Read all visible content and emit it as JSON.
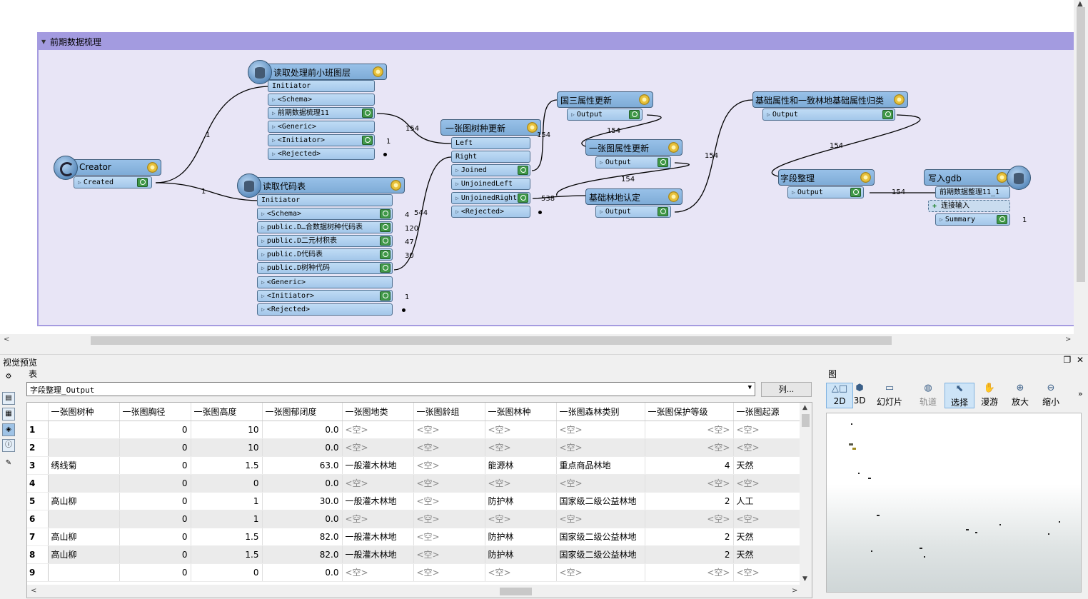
{
  "bookmark": {
    "title": "前期数据梳理"
  },
  "nodes": {
    "creator": {
      "title": "Creator",
      "ports": [
        "Created"
      ]
    },
    "reader1": {
      "title": "读取处理前小班图层",
      "init": "Initiator",
      "ports": [
        "<Schema>",
        "前期数据梳理11",
        "<Generic>",
        "<Initiator>",
        "<Rejected>"
      ]
    },
    "reader2": {
      "title": "读取代码表",
      "init": "Initiator",
      "ports": [
        "<Schema>",
        "public.D…合数据树种代码表",
        "public.D二元材积表",
        "public.D代码表",
        "public.D树种代码",
        "<Generic>",
        "<Initiator>",
        "<Rejected>"
      ]
    },
    "merger": {
      "title": "一张图树种更新",
      "inputs": [
        "Left",
        "Right"
      ],
      "ports": [
        "Joined",
        "UnjoinedLeft",
        "UnjoinedRight",
        "<Rejected>"
      ]
    },
    "t1": {
      "title": "国三属性更新",
      "ports": [
        "Output"
      ]
    },
    "t2": {
      "title": "一张图属性更新",
      "ports": [
        "Output"
      ]
    },
    "t3": {
      "title": "基础林地认定",
      "ports": [
        "Output"
      ]
    },
    "t4": {
      "title": "基础属性和一致林地基础属性归类",
      "ports": [
        "Output"
      ]
    },
    "t5": {
      "title": "字段整理",
      "ports": [
        "Output"
      ]
    },
    "writer": {
      "title": "写入gdb",
      "ports": [
        "前期数据整理11_1",
        "连接输入",
        "Summary"
      ]
    }
  },
  "counts": {
    "c1": "1",
    "c2": "1",
    "c3": "154",
    "c4": "1",
    "c5": "4",
    "c6": "544",
    "c7": "120",
    "c8": "47",
    "c9": "30",
    "c10": "1",
    "c11": "154",
    "c12": "538",
    "c13": "154",
    "c14": "154",
    "c15": "154",
    "c16": "154",
    "c17": "154",
    "c18": "1"
  },
  "panel": {
    "title": "视觉预览",
    "table_label": "表",
    "map_label": "图",
    "table_selected": "字段整理_Output",
    "columns_button": "列..."
  },
  "table": {
    "headers": [
      "一张图树种",
      "一张图胸径",
      "一张图高度",
      "一张图郁闭度",
      "一张图地类",
      "一张图龄组",
      "一张图林种",
      "一张图森林类别",
      "一张图保护等级",
      "一张图起源"
    ],
    "rows": [
      [
        "1",
        "",
        "0",
        "10",
        "0.0",
        "<空>",
        "<空>",
        "<空>",
        "<空>",
        "<空>",
        "<空>"
      ],
      [
        "2",
        "",
        "0",
        "10",
        "0.0",
        "<空>",
        "<空>",
        "<空>",
        "<空>",
        "<空>",
        "<空>"
      ],
      [
        "3",
        "绣线菊",
        "0",
        "1.5",
        "63.0",
        "一般灌木林地",
        "<空>",
        "能源林",
        "重点商品林地",
        "4",
        "天然"
      ],
      [
        "4",
        "",
        "0",
        "0",
        "0.0",
        "<空>",
        "<空>",
        "<空>",
        "<空>",
        "<空>",
        "<空>"
      ],
      [
        "5",
        "高山柳",
        "0",
        "1",
        "30.0",
        "一般灌木林地",
        "<空>",
        "防护林",
        "国家级二级公益林地",
        "2",
        "人工"
      ],
      [
        "6",
        "",
        "0",
        "1",
        "0.0",
        "<空>",
        "<空>",
        "<空>",
        "<空>",
        "<空>",
        "<空>"
      ],
      [
        "7",
        "高山柳",
        "0",
        "1.5",
        "82.0",
        "一般灌木林地",
        "<空>",
        "防护林",
        "国家级二级公益林地",
        "2",
        "天然"
      ],
      [
        "8",
        "高山柳",
        "0",
        "1.5",
        "82.0",
        "一般灌木林地",
        "<空>",
        "防护林",
        "国家级二级公益林地",
        "2",
        "天然"
      ],
      [
        "9",
        "",
        "0",
        "0",
        "0.0",
        "<空>",
        "<空>",
        "<空>",
        "<空>",
        "<空>",
        "<空>"
      ]
    ]
  },
  "map_toolbar": [
    "2D",
    "3D",
    "幻灯片",
    "轨道",
    "选择",
    "漫游",
    "放大",
    "缩小"
  ],
  "map_toolbar_active": "选择",
  "colors": {
    "bookmark": "#a39be0",
    "node": "#8eb8e2",
    "inspect": "#3f9848"
  }
}
